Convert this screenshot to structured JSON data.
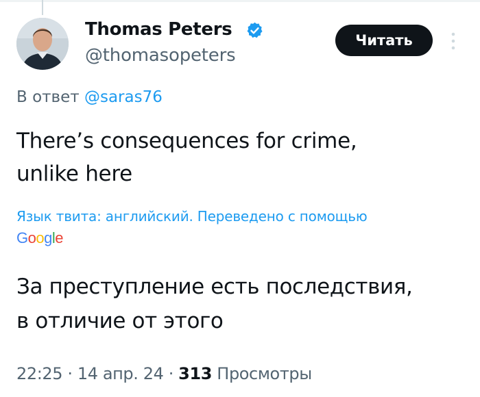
{
  "author": {
    "display_name": "Thomas Peters",
    "handle": "@thomasopeters",
    "avatar_icon": "person-photo"
  },
  "follow_button_label": "Читать",
  "reply": {
    "prefix": "В ответ ",
    "mention": "@saras76"
  },
  "tweet": {
    "line1": "There’s consequences for crime,",
    "line2": "unlike here"
  },
  "translation": {
    "note": "Язык твита: английский. Переведено с помощью",
    "provider": "Google",
    "line1": "За преступление есть последствия,",
    "line2": "в отличие от этого"
  },
  "meta": {
    "time": "22:25",
    "separator": " · ",
    "date": "14 апр. 24",
    "views_count": "313",
    "views_label": " Просмотры"
  },
  "colors": {
    "link": "#1d9bf0",
    "secondary_text": "#536471",
    "primary_text": "#0f1419",
    "verified": "#1d9bf0"
  }
}
